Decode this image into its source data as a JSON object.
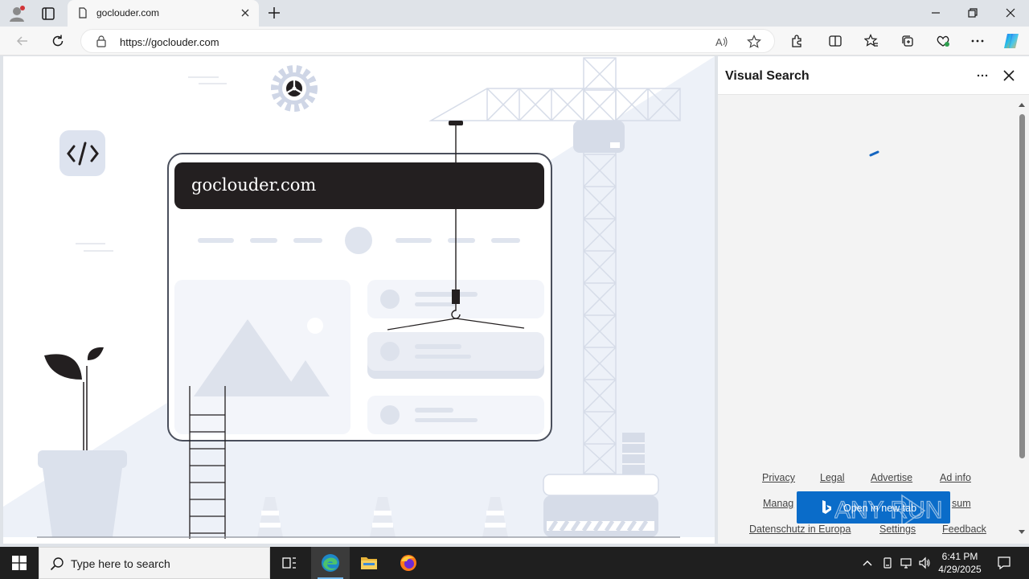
{
  "browser": {
    "tab": {
      "title": "goclouder.com"
    },
    "address": {
      "url": "https://goclouder.com"
    }
  },
  "page": {
    "banner_text": "goclouder.com"
  },
  "visual_search": {
    "title": "Visual Search",
    "links": {
      "privacy": "Privacy",
      "legal": "Legal",
      "advertise": "Advertise",
      "ad_info": "Ad info",
      "manage": "Manag",
      "consum": "sum",
      "datenschutz": "Datenschutz in Europa",
      "settings": "Settings",
      "feedback": "Feedback"
    },
    "open_button": "Open in new tab",
    "watermark": "ANY RUN"
  },
  "taskbar": {
    "search_placeholder": "Type here to search",
    "time": "6:41 PM",
    "date": "4/29/2025"
  },
  "colors": {
    "accent": "#0a6cc9",
    "banner": "#231f20",
    "illustration_fill": "#d9dfeb",
    "taskbar": "#1f1f1f"
  }
}
